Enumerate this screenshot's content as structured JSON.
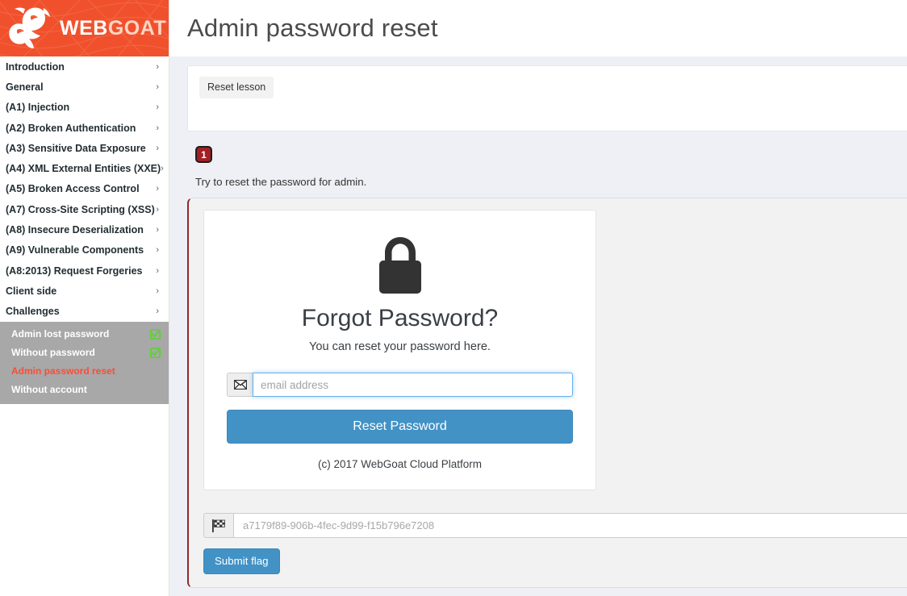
{
  "brand": {
    "name_part1": "WEB",
    "name_part2": "GOAT",
    "logo_icon": "goat-head-logo",
    "bg_color": "#f0512c"
  },
  "sidebar": {
    "items": [
      {
        "label": "Introduction",
        "chevron": "›"
      },
      {
        "label": "General",
        "chevron": "›"
      },
      {
        "label": "(A1) Injection",
        "chevron": "›"
      },
      {
        "label": "(A2) Broken Authentication",
        "chevron": "›"
      },
      {
        "label": "(A3) Sensitive Data Exposure",
        "chevron": "›"
      },
      {
        "label": "(A4) XML External Entities (XXE)",
        "chevron": "›"
      },
      {
        "label": "(A5) Broken Access Control",
        "chevron": "›"
      },
      {
        "label": "(A7) Cross-Site Scripting (XSS)",
        "chevron": "›"
      },
      {
        "label": "(A8) Insecure Deserialization",
        "chevron": "›"
      },
      {
        "label": "(A9) Vulnerable Components",
        "chevron": "›"
      },
      {
        "label": "(A8:2013) Request Forgeries",
        "chevron": "›"
      },
      {
        "label": "Client side",
        "chevron": "›"
      },
      {
        "label": "Challenges",
        "chevron": "›"
      }
    ],
    "submenu": [
      {
        "label": "Admin lost password",
        "completed": true,
        "current": false
      },
      {
        "label": "Without password",
        "completed": true,
        "current": false
      },
      {
        "label": "Admin password reset",
        "completed": false,
        "current": true
      },
      {
        "label": "Without account",
        "completed": false,
        "current": false
      }
    ],
    "submenu_bg": "#a8a8a8",
    "current_color": "#ff4b33",
    "check_color": "#5bd22e"
  },
  "header": {
    "title": "Admin password reset"
  },
  "lesson": {
    "reset_button": "Reset lesson",
    "step_number": "1",
    "description": "Try to reset the password for admin."
  },
  "forgot_card": {
    "lock_icon": "padlock-icon",
    "title": "Forgot Password?",
    "subtitle": "You can reset your password here.",
    "email_icon": "envelope-icon",
    "email_placeholder": "email address",
    "email_value": "",
    "submit_label": "Reset Password",
    "copyright": "(c) 2017 WebGoat Cloud Platform",
    "button_color": "#4292c6"
  },
  "flag_section": {
    "flag_icon": "checkered-flag-icon",
    "flag_placeholder": "a7179f89-906b-4fec-9d99-f15b796e7208",
    "flag_value": "",
    "submit_label": "Submit flag"
  }
}
